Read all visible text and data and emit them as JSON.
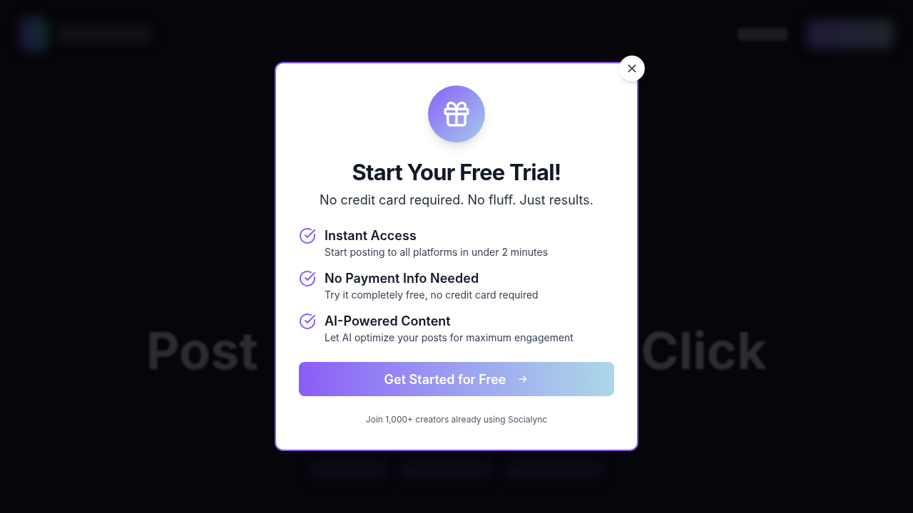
{
  "background": {
    "headline_left": "Post",
    "headline_right": "Click"
  },
  "modal": {
    "title": "Start Your Free Trial!",
    "subtitle": "No credit card required. No fluff. Just results.",
    "features": [
      {
        "title": "Instant Access",
        "description": "Start posting to all platforms in under 2 minutes"
      },
      {
        "title": "No Payment Info Needed",
        "description": "Try it completely free, no credit card required"
      },
      {
        "title": "AI-Powered Content",
        "description": "Let AI optimize your posts for maximum engagement"
      }
    ],
    "cta": "Get Started for Free",
    "footnote": "Join 1,000+ creators already using Socialync"
  }
}
